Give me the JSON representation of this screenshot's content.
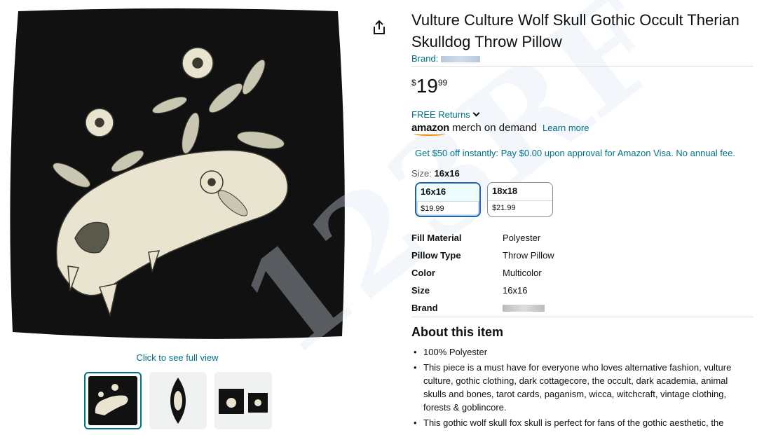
{
  "product": {
    "title": "Vulture Culture Wolf Skull Gothic Occult Therian Skulldog Throw Pillow",
    "brand_label": "Brand:",
    "price": {
      "symbol": "$",
      "whole": "19",
      "fraction": "99"
    },
    "free_returns": "FREE Returns",
    "merch_logo_amazon": "amazon",
    "merch_logo_text": "merch on demand",
    "learn_more": "Learn more",
    "promo": "Get $50 off instantly: Pay $0.00 upon approval for Amazon Visa. No annual fee."
  },
  "size": {
    "label": "Size:",
    "selected": "16x16",
    "options": [
      {
        "name": "16x16",
        "price": "$19.99",
        "selected": true
      },
      {
        "name": "18x18",
        "price": "$21.99",
        "selected": false
      }
    ]
  },
  "specs": [
    {
      "key": "Fill Material",
      "value": "Polyester"
    },
    {
      "key": "Pillow Type",
      "value": "Throw Pillow"
    },
    {
      "key": "Color",
      "value": "Multicolor"
    },
    {
      "key": "Size",
      "value": "16x16"
    },
    {
      "key": "Brand",
      "value": ""
    }
  ],
  "about": {
    "heading": "About this item",
    "bullets": [
      "100% Polyester",
      "This piece is a must have for everyone who loves alternative fashion, vulture culture, gothic clothing, dark cottagecore, the occult, dark academia, animal skulls and bones, tarot cards, paganism, wicca, witchcraft, vintage clothing, forests & goblincore.",
      "This gothic wolf skull fox skull is perfect for fans of the gothic aesthetic, the"
    ]
  },
  "gallery": {
    "click_full_view": "Click to see full view",
    "thumbnails": [
      "front",
      "side",
      "pair"
    ]
  },
  "icons": {
    "share": "share-icon",
    "chevron": "chevron-down-icon"
  },
  "colors": {
    "link": "#007185",
    "pillow": "#111111",
    "artwork": "#e9e4cf",
    "selected_border": "#2162a1"
  }
}
